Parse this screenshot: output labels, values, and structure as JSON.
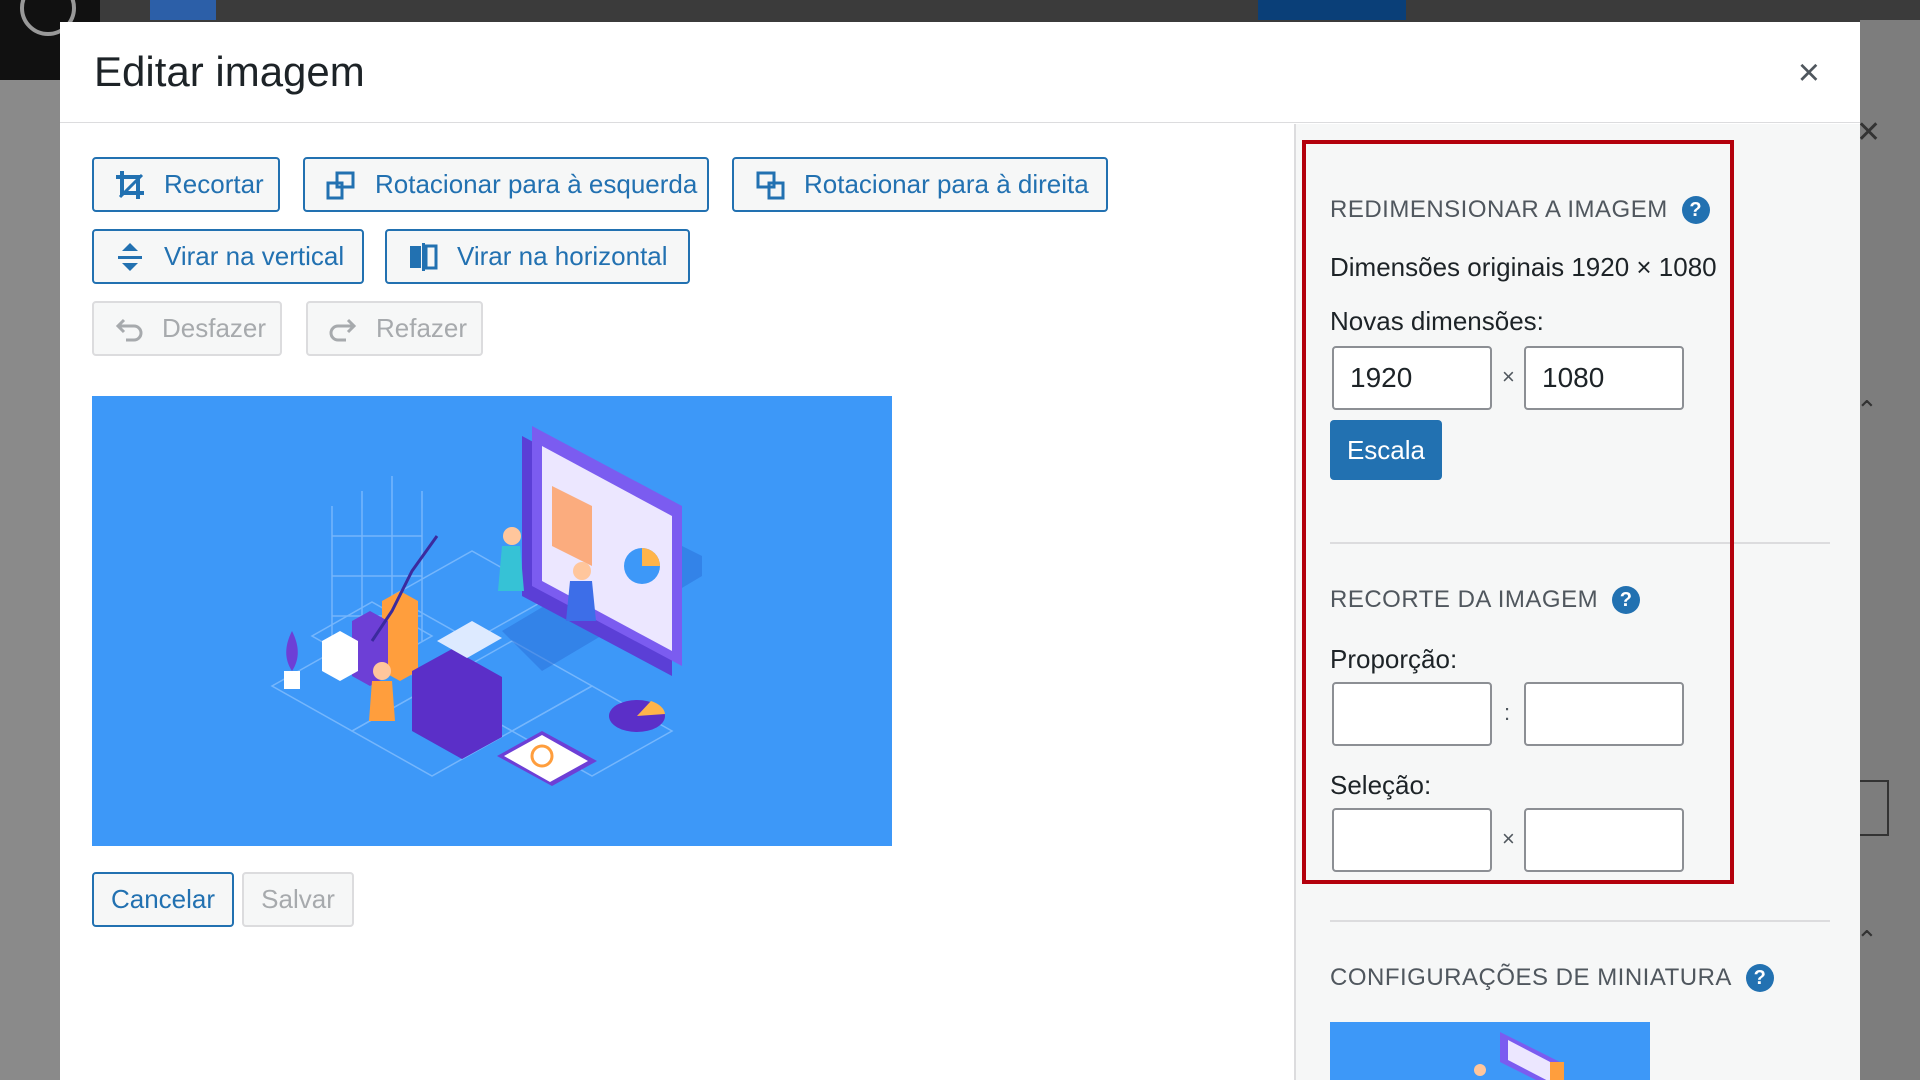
{
  "modal": {
    "title": "Editar imagem",
    "close_symbol": "×"
  },
  "toolbar": {
    "crop_label": "Recortar",
    "rotate_left_label": "Rotacionar para à esquerda",
    "rotate_right_label": "Rotacionar para à direita",
    "flip_vertical_label": "Virar na vertical",
    "flip_horizontal_label": "Virar na horizontal",
    "undo_label": "Desfazer",
    "redo_label": "Refazer"
  },
  "actions": {
    "cancel_label": "Cancelar",
    "save_label": "Salvar"
  },
  "resize": {
    "title": "REDIMENSIONAR A IMAGEM",
    "original_text": "Dimensões originais 1920 × 1080",
    "new_label": "Novas dimensões:",
    "width_value": "1920",
    "height_value": "1080",
    "separator": "×",
    "scale_label": "Escala"
  },
  "crop": {
    "title": "RECORTE DA IMAGEM",
    "ratio_label": "Proporção:",
    "ratio_separator": ":",
    "selection_label": "Seleção:",
    "selection_separator": "×",
    "ratio_w": "",
    "ratio_h": "",
    "sel_w": "",
    "sel_h": ""
  },
  "thumbnail": {
    "title": "CONFIGURAÇÕES DE MINIATURA"
  },
  "help_symbol": "?",
  "colors": {
    "accent": "#2271b1",
    "highlight": "#b3000c",
    "image_bg": "#3d98f8"
  }
}
